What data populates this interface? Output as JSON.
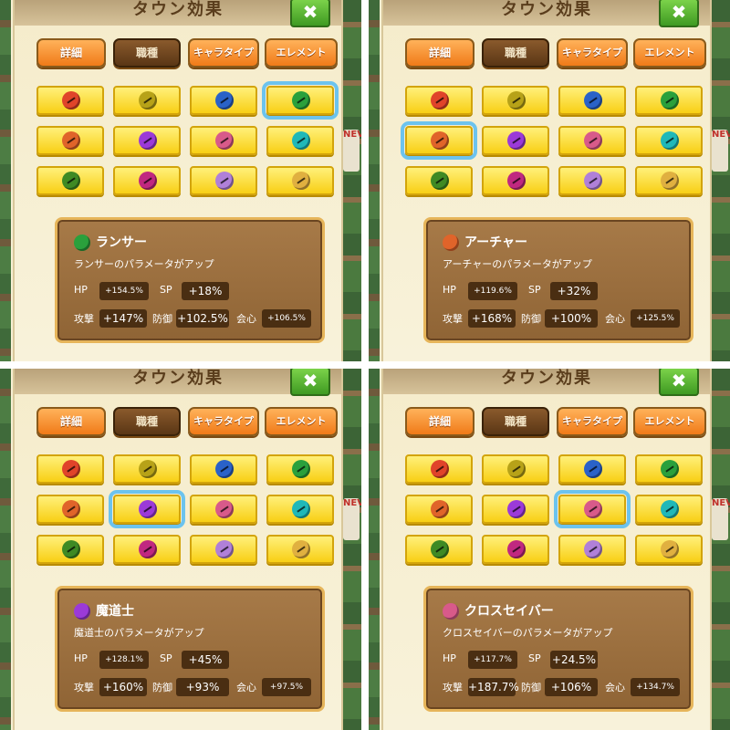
{
  "title": "タウン効果",
  "close_label": "✖",
  "tabs": [
    "詳細",
    "職種",
    "キャラタイプ",
    "エレメント"
  ],
  "side_sign": "NEV",
  "colors": {
    "jobs": [
      "#e0442a",
      "#b7a218",
      "#2a62c8",
      "#2aa03c",
      "#e0642a",
      "#9b3ad8",
      "#d85a8a",
      "#20b8b8",
      "#3f8a24",
      "#c02880",
      "#b080d8",
      "#e0b040"
    ]
  },
  "jobs": [
    {
      "icon": "sword-icon"
    },
    {
      "icon": "hammer-icon"
    },
    {
      "icon": "lance-icon"
    },
    {
      "icon": "spear-icon"
    },
    {
      "icon": "bow-icon"
    },
    {
      "icon": "staff-icon"
    },
    {
      "icon": "crossbow-icon"
    },
    {
      "icon": "gun-icon"
    },
    {
      "icon": "leaf-icon"
    },
    {
      "icon": "wand-icon"
    },
    {
      "icon": "book-icon"
    },
    {
      "icon": "bird-icon"
    }
  ],
  "panels": [
    {
      "selected": 3,
      "name": "ランサー",
      "desc": "ランサーのパラメータがアップ",
      "hp_label": "HP",
      "hp": "+154.5%",
      "sp_label": "SP",
      "sp": "+18%",
      "atk_label": "攻撃",
      "atk": "+147%",
      "def_label": "防御",
      "def": "+102.5%",
      "crit_label": "会心",
      "crit": "+106.5%"
    },
    {
      "selected": 4,
      "name": "アーチャー",
      "desc": "アーチャーのパラメータがアップ",
      "hp_label": "HP",
      "hp": "+119.6%",
      "sp_label": "SP",
      "sp": "+32%",
      "atk_label": "攻撃",
      "atk": "+168%",
      "def_label": "防御",
      "def": "+100%",
      "crit_label": "会心",
      "crit": "+125.5%"
    },
    {
      "selected": 5,
      "name": "魔道士",
      "desc": "魔道士のパラメータがアップ",
      "hp_label": "HP",
      "hp": "+128.1%",
      "sp_label": "SP",
      "sp": "+45%",
      "atk_label": "攻撃",
      "atk": "+160%",
      "def_label": "防御",
      "def": "+93%",
      "crit_label": "会心",
      "crit": "+97.5%"
    },
    {
      "selected": 6,
      "name": "クロスセイバー",
      "desc": "クロスセイバーのパラメータがアップ",
      "hp_label": "HP",
      "hp": "+117.7%",
      "sp_label": "SP",
      "sp": "+24.5%",
      "atk_label": "攻撃",
      "atk": "+187.7%",
      "def_label": "防御",
      "def": "+106%",
      "crit_label": "会心",
      "crit": "+134.7%"
    }
  ]
}
